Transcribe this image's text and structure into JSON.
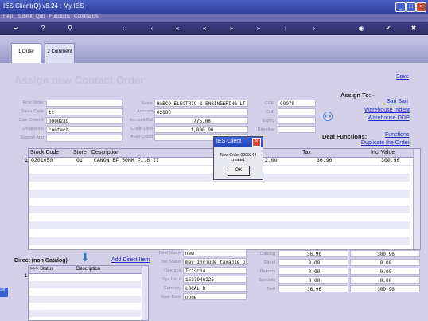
{
  "window": {
    "title": "IES Client(Q) v8.24 : My IES"
  },
  "menu": [
    "Help",
    "Submit",
    "Quit",
    "Functions",
    "Commands"
  ],
  "tabs": [
    {
      "label": "1 Order"
    },
    {
      "label": "2 Comment"
    }
  ],
  "heading": "Assign new Contact Order",
  "save_link": "Save",
  "left_fields": [
    {
      "label": "First Order",
      "value": ""
    },
    {
      "label": "Sales Code",
      "value": "tt"
    },
    {
      "label": "Cust Order #",
      "value": "0000239"
    },
    {
      "label": "Origination",
      "value": "contact"
    },
    {
      "label": "Deposit Amt",
      "value": ""
    }
  ],
  "mid_fields": [
    {
      "label": "Name",
      "value": "HABCO ELECTRIC & ENGINEERING LT"
    },
    {
      "label": "Account",
      "value": "02088"
    },
    {
      "label": "Account Bal",
      "value": "775.08"
    },
    {
      "label": "Credit Limit",
      "value": "1,000.00"
    },
    {
      "label": "Avail Credit",
      "value": ""
    }
  ],
  "right_fields": [
    {
      "label": "CRM",
      "value": "00078"
    },
    {
      "label": "Club",
      "value": ""
    },
    {
      "label": "Expiry",
      "value": ""
    },
    {
      "label": "Directive",
      "value": ""
    }
  ],
  "assign_to": {
    "title": "Assign To: -",
    "links": [
      "Sari Sari",
      "Warehouse Indent",
      "Warehouse ODP"
    ]
  },
  "deal_functions": {
    "title": "Deal Functions:",
    "functions": "Functions",
    "duplicate": "Duplicate the Order"
  },
  "grid": {
    "headers": [
      "Stock Code",
      "Store",
      "Description",
      "Tax",
      "Incl Value"
    ],
    "rows": [
      {
        "idx": "1",
        "code": "0201650",
        "store": "01",
        "desc": "CANON EF 50MM F1.8 II",
        "qty": "2.00",
        "tax": "36.96",
        "incl": "300.96"
      }
    ]
  },
  "dialog": {
    "title": "IES Client",
    "message": "New Order 0000244 created.",
    "ok": "OK"
  },
  "direct": {
    "title": "Direct (non Catalog)",
    "add_link": "Add Direct Item",
    "headers": [
      ">>> Status",
      "Description"
    ],
    "row_idx": "1"
  },
  "deal_info": [
    {
      "label": "Deal Status",
      "value": "new"
    },
    {
      "label": "Tax Status",
      "value": "may include taxable o"
    },
    {
      "label": "Operator",
      "value": "Trischa"
    },
    {
      "label": "Sys Ref #",
      "value": "1537946225"
    },
    {
      "label": "Currency",
      "value": "LOCAL R"
    },
    {
      "label": "Rate Book",
      "value": "none"
    }
  ],
  "totals": [
    {
      "label": "Catalog",
      "a": "36.96",
      "b": "300.96"
    },
    {
      "label": "Direct",
      "a": "0.00",
      "b": "0.00"
    },
    {
      "label": "Returns",
      "a": "0.00",
      "b": "0.00"
    },
    {
      "label": "Specials",
      "a": "0.00",
      "b": "0.00"
    },
    {
      "label": "Nett",
      "a": "36.96",
      "b": "300.96"
    }
  ],
  "colors": {
    "titlebar": "#2f3f9c",
    "toolbar": "#2a2b63",
    "content": "#d4d0e8",
    "link": "#1a2ec0"
  }
}
